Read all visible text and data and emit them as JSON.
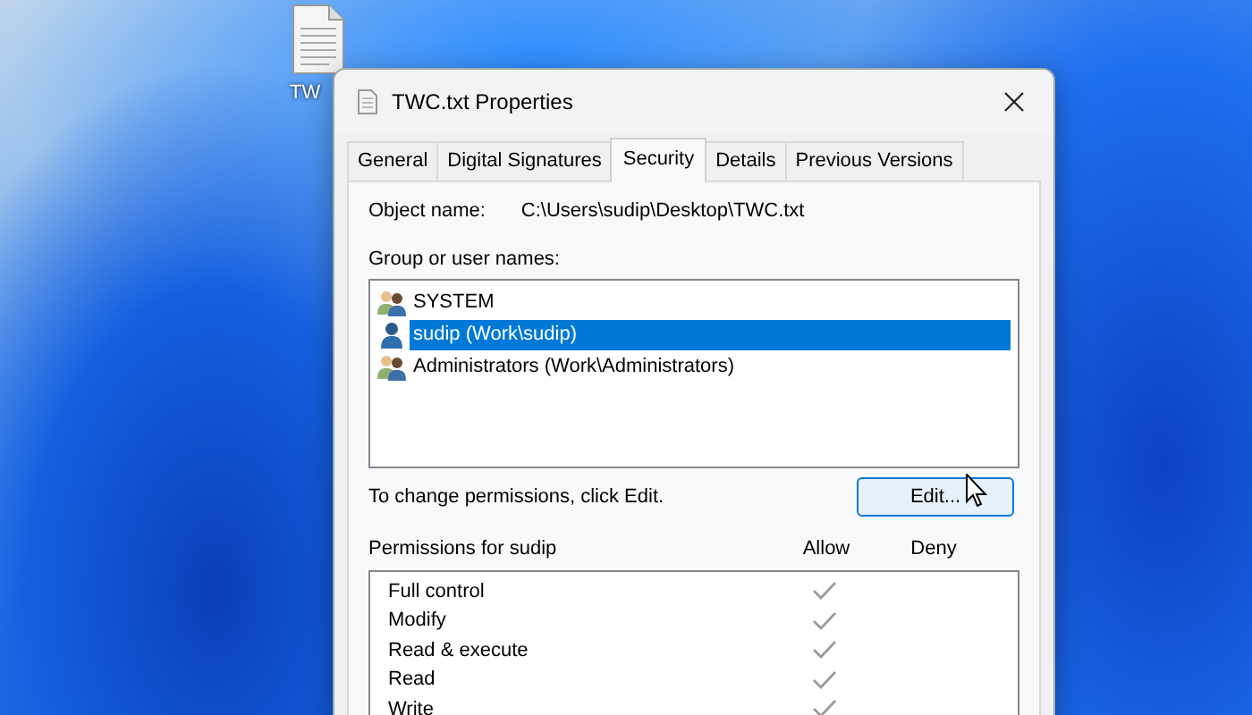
{
  "desktop_icon": {
    "label": "TW"
  },
  "window": {
    "title": "TWC.txt Properties"
  },
  "tabs": [
    {
      "label": "General",
      "selected": false
    },
    {
      "label": "Digital Signatures",
      "selected": false
    },
    {
      "label": "Security",
      "selected": true
    },
    {
      "label": "Details",
      "selected": false
    },
    {
      "label": "Previous Versions",
      "selected": false
    }
  ],
  "object_name": {
    "label": "Object name:",
    "value": "C:\\Users\\sudip\\Desktop\\TWC.txt"
  },
  "users": {
    "label": "Group or user names:",
    "items": [
      {
        "name": "SYSTEM",
        "kind": "group",
        "selected": false
      },
      {
        "name": "sudip (Work\\sudip)",
        "kind": "user",
        "selected": true
      },
      {
        "name": "Administrators (Work\\Administrators)",
        "kind": "group",
        "selected": false
      }
    ]
  },
  "change_hint": "To change permissions, click Edit.",
  "edit_button": "Edit...",
  "permissions": {
    "label": "Permissions for sudip",
    "allow_header": "Allow",
    "deny_header": "Deny",
    "rows": [
      {
        "name": "Full control",
        "allow": true,
        "deny": false
      },
      {
        "name": "Modify",
        "allow": true,
        "deny": false
      },
      {
        "name": "Read & execute",
        "allow": true,
        "deny": false
      },
      {
        "name": "Read",
        "allow": true,
        "deny": false
      },
      {
        "name": "Write",
        "allow": true,
        "deny": false
      }
    ]
  }
}
